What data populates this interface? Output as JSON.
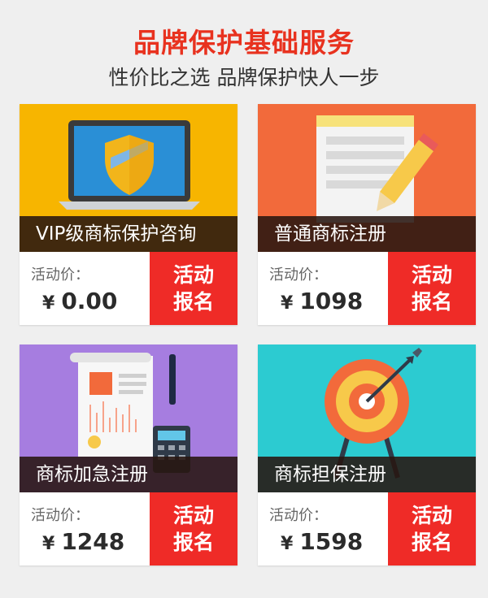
{
  "header": {
    "title": "品牌保护基础服务",
    "subtitle": "性价比之选 品牌保护快人一步"
  },
  "cards": [
    {
      "name": "VIP级商标保护咨询",
      "price_label": "活动价：",
      "currency": "¥",
      "price": "0.00",
      "button_line1": "活动",
      "button_line2": "报名",
      "banner_color": "#f7b500",
      "icon": "shield-laptop-icon"
    },
    {
      "name": "普通商标注册",
      "price_label": "活动价：",
      "currency": "¥",
      "price": "1098",
      "button_line1": "活动",
      "button_line2": "报名",
      "banner_color": "#f26a3b",
      "icon": "document-pencil-icon"
    },
    {
      "name": "商标加急注册",
      "price_label": "活动价：",
      "currency": "¥",
      "price": "1248",
      "button_line1": "活动",
      "button_line2": "报名",
      "banner_color": "#a67de0",
      "icon": "report-calculator-icon"
    },
    {
      "name": "商标担保注册",
      "price_label": "活动价：",
      "currency": "¥",
      "price": "1598",
      "button_line1": "活动",
      "button_line2": "报名",
      "banner_color": "#2ccbd1",
      "icon": "target-arrow-icon"
    }
  ],
  "colors": {
    "title": "#e8321f",
    "button": "#ef2b27"
  }
}
